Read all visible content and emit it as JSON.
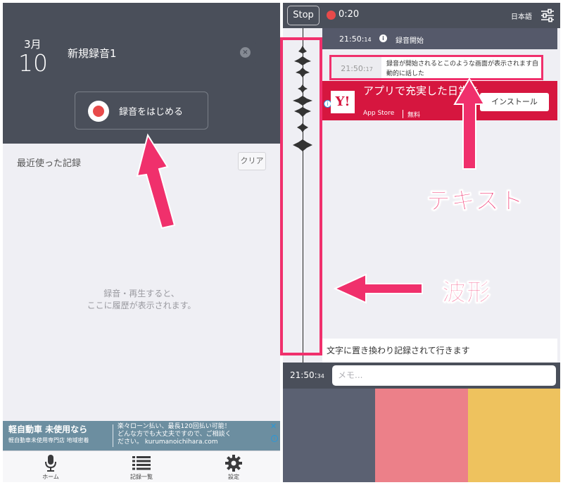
{
  "left_screen": {
    "date": {
      "month": "3月",
      "day": "10"
    },
    "title_field": {
      "value": "新規録音1"
    },
    "record_button": {
      "label": "録音をはじめる"
    },
    "recent": {
      "label": "最近使った記録",
      "clear_label": "クリア"
    },
    "empty_message": {
      "line1": "録音・再生すると、",
      "line2": "ここに履歴が表示されます。"
    },
    "ad": {
      "title": "軽自動車 未使用なら",
      "subtitle": "軽自動車未使用専門店 地域密着",
      "line1": "楽々ローン払い、最長120回払い可能！",
      "line2": "どんな方でも大丈夫ですので、ご相談く",
      "line3": "ださい。 kurumanoichihara.com"
    },
    "tabs": [
      {
        "label": "ホーム",
        "icon": "microphone-icon"
      },
      {
        "label": "記録一覧",
        "icon": "list-icon"
      },
      {
        "label": "設定",
        "icon": "gear-icon"
      }
    ]
  },
  "right_screen": {
    "stop_label": "Stop",
    "elapsed": "0:20",
    "language": "日本語",
    "system_row": {
      "time": "21:50:",
      "seconds": "14",
      "message": "録音開始"
    },
    "entry": {
      "time": "21:50:",
      "seconds": "17",
      "text": "録音が開始されるとこのような画面が表示されます自動的に話した"
    },
    "ad": {
      "logo": "Y!",
      "title": "アプリで充実した日常を",
      "store": "App Store",
      "price": "無料",
      "install_label": "インストール"
    },
    "bottom_text": "文字に置き換わり記録されて行きます",
    "memo": {
      "time": "21:50:",
      "seconds": "34",
      "placeholder": "メモ..."
    },
    "swatches": [
      "#5b6172",
      "#ec8089",
      "#eec25e"
    ]
  },
  "annotations": {
    "text_label": "テキスト",
    "waveform_label": "波形",
    "color": "#f0306c"
  }
}
